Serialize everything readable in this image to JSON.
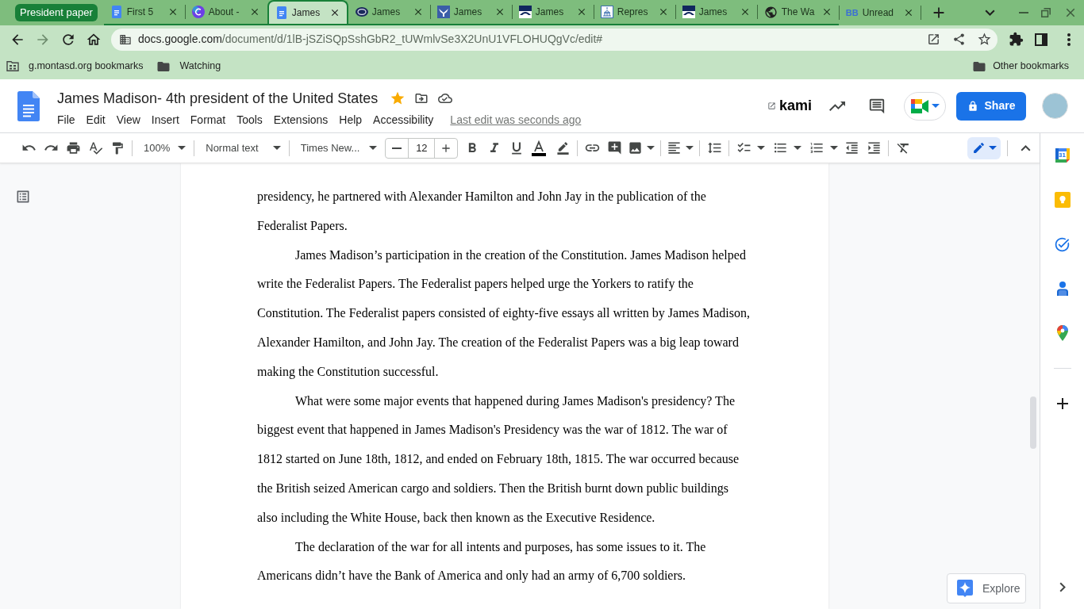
{
  "browser": {
    "tab_group": {
      "label": "President paper",
      "tabs": [
        {
          "title": "First 5",
          "kind": "doc",
          "selected": false
        },
        {
          "title": "About -",
          "kind": "circle_logo",
          "selected": false
        },
        {
          "title": "James",
          "kind": "doc",
          "selected": true
        },
        {
          "title": "James",
          "kind": "seal",
          "selected": false
        },
        {
          "title": "James",
          "kind": "emblem",
          "selected": false
        },
        {
          "title": "James",
          "kind": "arch",
          "selected": false
        },
        {
          "title": "Repres",
          "kind": "capitol",
          "selected": false
        },
        {
          "title": "James",
          "kind": "arch",
          "selected": false
        },
        {
          "title": "The Wa",
          "kind": "globe",
          "selected": false
        }
      ]
    },
    "tabs": [
      {
        "title": "Unread",
        "kind": "letters",
        "logo": "BB",
        "selected": false
      }
    ],
    "nav": [
      {
        "kind": "back",
        "disabled": false
      },
      {
        "kind": "forward",
        "disabled": true
      },
      {
        "kind": "reload",
        "disabled": false
      },
      {
        "kind": "home",
        "disabled": false
      }
    ],
    "address": {
      "host": "docs.google.com",
      "path": "/document/d/1lB-jSZiSQpSshGbR2_tUWmlvSe3X2UnU1VFLOHUQgVc/edit#"
    },
    "bookmarks": [
      {
        "label": "g.montasd.org bookmarks",
        "kind": "managed"
      },
      {
        "label": "Watching",
        "kind": "folder"
      }
    ],
    "other_bookmarks": {
      "label": "Other bookmarks"
    }
  },
  "docs": {
    "title": "James Madison- 4th president of the United States",
    "starred": true,
    "menu": [
      "File",
      "Edit",
      "View",
      "Insert",
      "Format",
      "Tools",
      "Extensions",
      "Help",
      "Accessibility"
    ],
    "last_edit": "Last edit was seconds ago",
    "kami": "kami",
    "share": "Share"
  },
  "toolbar": {
    "zoom": "100%",
    "style": "Normal text",
    "font": "Times New...",
    "font_size": "12"
  },
  "document": {
    "paragraphs": [
      {
        "kind": "continuation",
        "text": "presidency, he partnered with Alexander Hamilton and John Jay in the publication of the Federalist Papers."
      },
      {
        "kind": "paragraph",
        "text": "James Madison’s participation in the creation of the Constitution. James Madison helped write the Federalist Papers. The Federalist papers helped urge the Yorkers to ratify the Constitution. The Federalist papers consisted of eighty-five essays all written by James Madison, Alexander Hamilton, and John Jay. The creation of the Federalist Papers was a big leap toward making the Constitution successful."
      },
      {
        "kind": "paragraph",
        "text": "What were some major events that happened during James Madison's presidency? The biggest event that happened in James Madison's Presidency was the war of 1812. The war of 1812 started on June 18th, 1812, and ended on February 18th, 1815. The war occurred because the British seized American cargo and soldiers. Then the British burnt down public buildings also including the White House, back then known as the Executive Residence."
      },
      {
        "kind": "paragraph",
        "text": "The declaration of the war for all intents and purposes, has some issues to it. The Americans didn’t have the Bank of America and only had an army of 6,700 soldiers."
      }
    ]
  },
  "side_panel": {
    "apps": [
      {
        "kind": "calendar",
        "label": "31"
      },
      {
        "kind": "keep"
      },
      {
        "kind": "tasks"
      },
      {
        "kind": "contacts"
      },
      {
        "kind": "maps"
      }
    ]
  },
  "explore": {
    "label": "Explore"
  }
}
